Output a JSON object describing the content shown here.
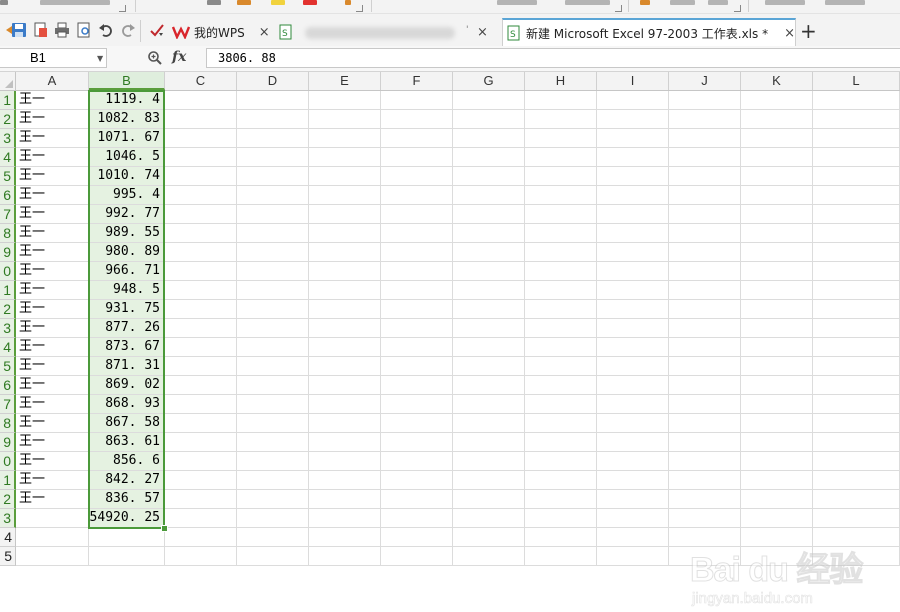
{
  "tabs": {
    "wps_label": "我的WPS",
    "excel_label": "新建 Microsoft Excel 97-2003 工作表.xls *",
    "close_glyph": "×",
    "new_tab_glyph": "+"
  },
  "formula_bar": {
    "name_box": "B1",
    "fx": "fx",
    "value": "3806. 88"
  },
  "columns": [
    "A",
    "B",
    "C",
    "D",
    "E",
    "F",
    "G",
    "H",
    "I",
    "J",
    "K",
    "L"
  ],
  "selected_column": "B",
  "rows": [
    {
      "n": "1",
      "a": "王一",
      "b": "1119. 4"
    },
    {
      "n": "2",
      "a": "王一",
      "b": "1082. 83"
    },
    {
      "n": "3",
      "a": "王一",
      "b": "1071. 67"
    },
    {
      "n": "4",
      "a": "王一",
      "b": "1046. 5"
    },
    {
      "n": "5",
      "a": "王一",
      "b": "1010. 74"
    },
    {
      "n": "6",
      "a": "王一",
      "b": "995. 4"
    },
    {
      "n": "7",
      "a": "王一",
      "b": "992. 77"
    },
    {
      "n": "8",
      "a": "王一",
      "b": "989. 55"
    },
    {
      "n": "9",
      "a": "王一",
      "b": "980. 89"
    },
    {
      "n": "0",
      "a": "王一",
      "b": "966. 71"
    },
    {
      "n": "1",
      "a": "王一",
      "b": "948. 5"
    },
    {
      "n": "2",
      "a": "王一",
      "b": "931. 75"
    },
    {
      "n": "3",
      "a": "王一",
      "b": "877. 26"
    },
    {
      "n": "4",
      "a": "王一",
      "b": "873. 67"
    },
    {
      "n": "5",
      "a": "王一",
      "b": "871. 31"
    },
    {
      "n": "6",
      "a": "王一",
      "b": "869. 02"
    },
    {
      "n": "7",
      "a": "王一",
      "b": "868. 93"
    },
    {
      "n": "8",
      "a": "王一",
      "b": "867. 58"
    },
    {
      "n": "9",
      "a": "王一",
      "b": "863. 61"
    },
    {
      "n": "0",
      "a": "王一",
      "b": "856. 6"
    },
    {
      "n": "1",
      "a": "王一",
      "b": "842. 27"
    },
    {
      "n": "2",
      "a": "王一",
      "b": "836. 57"
    },
    {
      "n": "3",
      "a": "",
      "b": "54920. 25"
    },
    {
      "n": "4",
      "a": "",
      "b": ""
    },
    {
      "n": "5",
      "a": "",
      "b": ""
    }
  ],
  "watermark": {
    "logo": "Bai du 经验",
    "url": "jingyan.baidu.com"
  },
  "colors": {
    "selection": "#4b9a3a",
    "selection_fill": "#e5f2e1",
    "tab_accent": "#5aa5d6"
  }
}
